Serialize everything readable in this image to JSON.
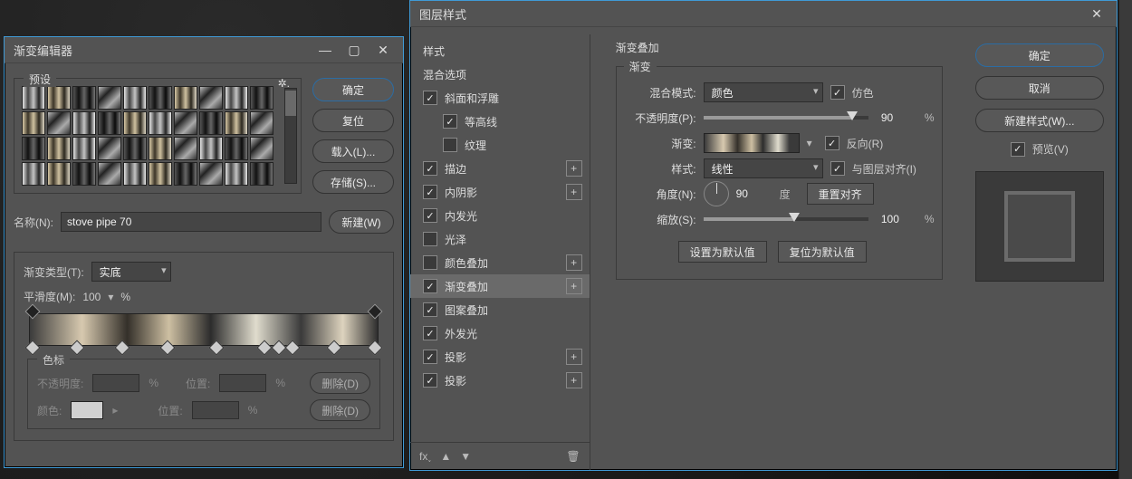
{
  "gradient_editor": {
    "title": "渐变编辑器",
    "presets_label": "预设",
    "buttons": {
      "ok": "确定",
      "reset": "复位",
      "load": "载入(L)...",
      "save": "存储(S)...",
      "new": "新建(W)"
    },
    "name_label": "名称(N):",
    "name_value": "stove pipe 70",
    "grad_type_label": "渐变类型(T):",
    "grad_type_value": "实底",
    "smoothness_label": "平滑度(M):",
    "smoothness_value": "100",
    "percent": "%",
    "stops_legend": "色标",
    "opacity_label": "不透明度:",
    "location_label": "位置:",
    "color_label": "颜色:",
    "delete_label": "删除(D)"
  },
  "layer_style": {
    "title": "图层样式",
    "col1_title": "样式",
    "blend_options": "混合选项",
    "items": {
      "bevel": "斜面和浮雕",
      "contour": "等高线",
      "texture": "纹理",
      "stroke": "描边",
      "inner_shadow": "内阴影",
      "inner_glow": "内发光",
      "satin": "光泽",
      "color_overlay": "颜色叠加",
      "gradient_overlay": "渐变叠加",
      "pattern_overlay": "图案叠加",
      "outer_glow": "外发光",
      "drop_shadow": "投影",
      "drop_shadow2": "投影"
    },
    "section_title": "渐变叠加",
    "sub_title": "渐变",
    "blend_mode_label": "混合模式:",
    "blend_mode_value": "颜色",
    "dither_label": "仿色",
    "opacity_label": "不透明度(P):",
    "opacity_value": "90",
    "percent": "%",
    "gradient_label": "渐变:",
    "reverse_label": "反向(R)",
    "style_label": "样式:",
    "style_value": "线性",
    "align_label": "与图层对齐(I)",
    "angle_label": "角度(N):",
    "angle_value": "90",
    "degree": "度",
    "reset_align": "重置对齐",
    "scale_label": "缩放(S):",
    "scale_value": "100",
    "make_default": "设置为默认值",
    "reset_default": "复位为默认值",
    "buttons": {
      "ok": "确定",
      "cancel": "取消",
      "new_style": "新建样式(W)...",
      "preview": "预览(V)"
    }
  }
}
